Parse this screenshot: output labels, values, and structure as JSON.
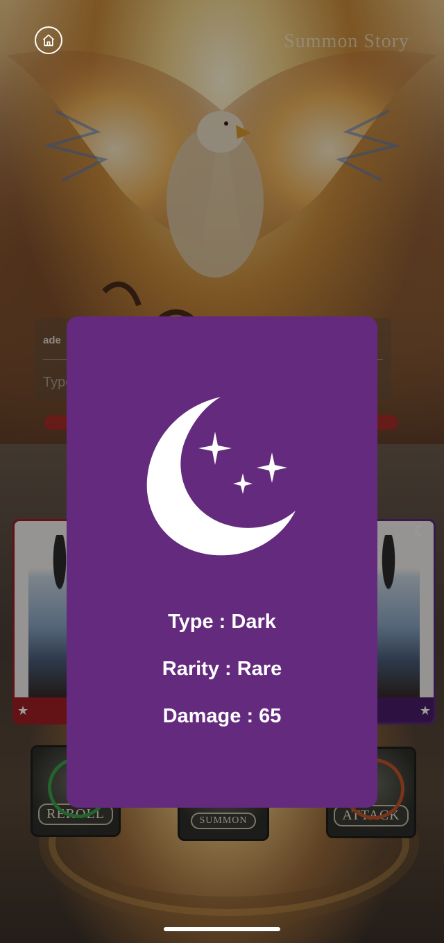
{
  "header": {
    "title": "Summon Story",
    "home_icon": "home-icon"
  },
  "chat": {
    "username": "ade",
    "input_placeholder": "Type"
  },
  "actions": {
    "reroll_label": "REROLL",
    "summon_label": "SUMMON",
    "attack_label": "ATTACK"
  },
  "card_detail": {
    "icon": "moon-stars-icon",
    "background_color": "#632a7d",
    "type_text": "Type : Dark",
    "rarity_text": "Rarity : Rare",
    "damage_text": "Damage : 65"
  }
}
